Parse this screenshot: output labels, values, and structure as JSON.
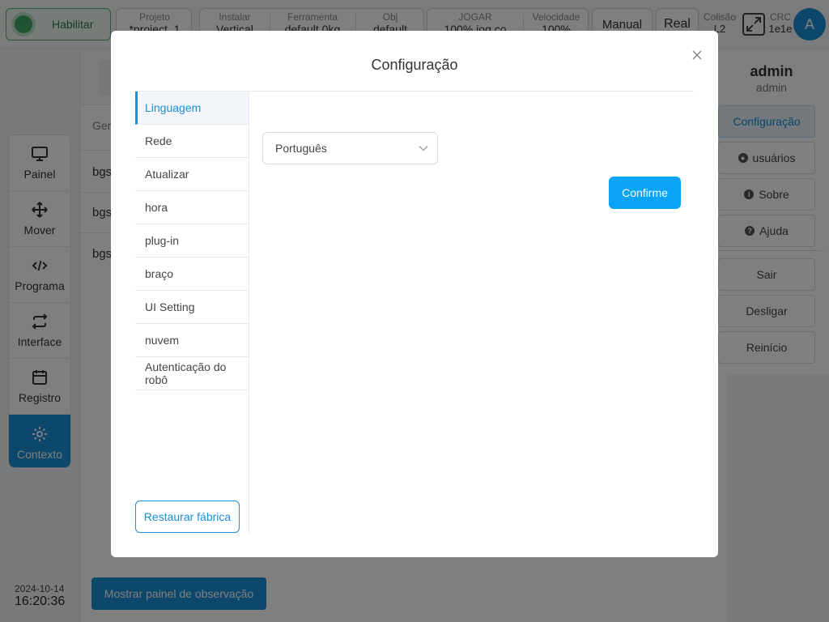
{
  "topbar": {
    "enable_label": "Habilitar",
    "project": {
      "label": "Projeto",
      "value": "*project_1"
    },
    "install": {
      "label": "Instalar",
      "value": "Vertical"
    },
    "tool": {
      "label": "Ferramenta",
      "value": "default"
    },
    "tool_load": "0kg",
    "obj": {
      "label": "Obj",
      "value": "default"
    },
    "jog": {
      "label": "JOGAR",
      "value": "100%"
    },
    "jog_coord": "jog.co",
    "speed": {
      "label": "Velocidade",
      "value": "100%"
    },
    "mode_manual": "Manual",
    "mode_real": "Real",
    "collision": {
      "label": "Colisão",
      "value": "L2"
    },
    "crc": {
      "label": "CRC",
      "value": "1e1e"
    },
    "avatar_initial": "A"
  },
  "leftnav": {
    "items": [
      {
        "label": "Painel",
        "icon": "monitor-icon"
      },
      {
        "label": "Mover",
        "icon": "move-icon"
      },
      {
        "label": "Programa",
        "icon": "code-icon"
      },
      {
        "label": "Interface",
        "icon": "swap-icon"
      },
      {
        "label": "Registro",
        "icon": "calendar-icon"
      },
      {
        "label": "Contexto",
        "icon": "gear-icon"
      }
    ],
    "active_index": 5
  },
  "datetime": {
    "date": "2024-10-14",
    "time": "16:20:36"
  },
  "main": {
    "column_header": "Ger",
    "rows": [
      "bgs",
      "bgs",
      "bgs"
    ],
    "watch_button": "Mostrar painel de observação"
  },
  "rightmenu": {
    "user_name": "admin",
    "user_role": "admin",
    "config": "Configuração",
    "users": "usuários",
    "about": "Sobre",
    "help": "Ajuda",
    "logout": "Sair",
    "shutdown": "Desligar",
    "restart": "Reinício"
  },
  "modal": {
    "title": "Configuração",
    "menu": [
      "Linguagem",
      "Rede",
      "Atualizar",
      "hora",
      "plug-in",
      "braço",
      "UI Setting",
      "nuvem",
      "Autenticação do robô"
    ],
    "active_index": 0,
    "factory_reset": "Restaurar fábrica",
    "language_value": "Português",
    "confirm": "Confirme"
  },
  "colors": {
    "accent": "#1a8ed6",
    "confirm": "#0aa4f5",
    "enable_green": "#3fa765"
  }
}
